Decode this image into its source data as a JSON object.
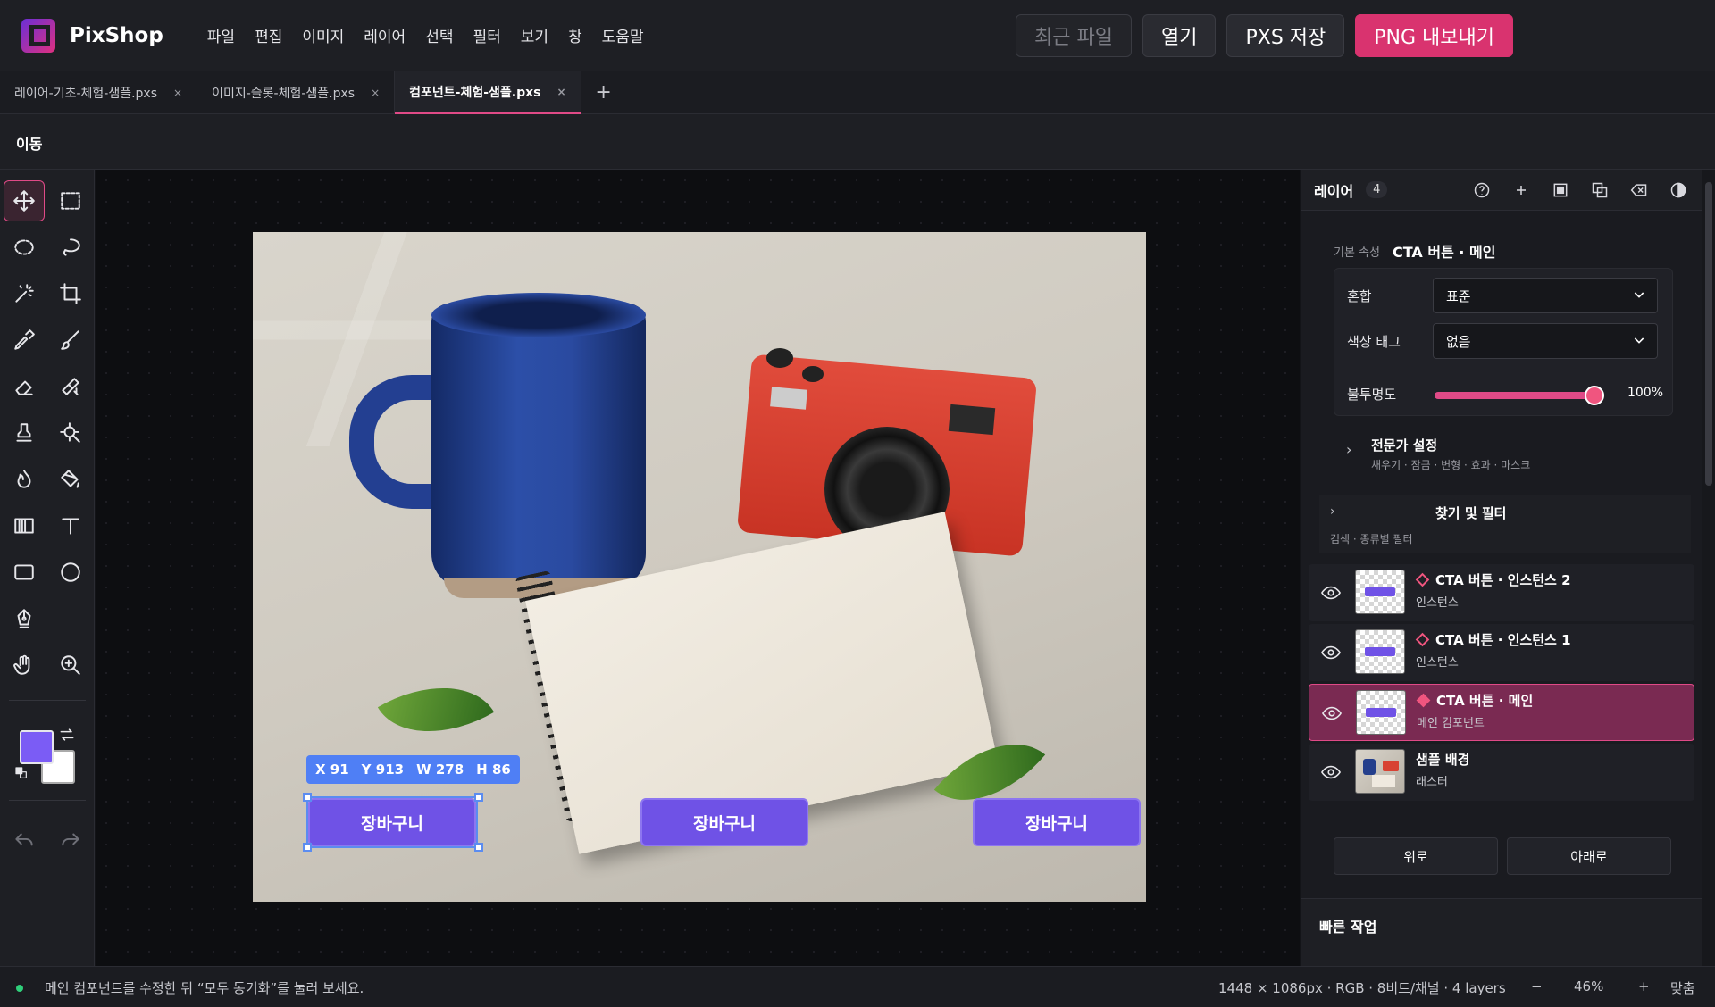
{
  "app": {
    "name": "PixShop"
  },
  "menu": [
    "파일",
    "편집",
    "이미지",
    "레이어",
    "선택",
    "필터",
    "보기",
    "창",
    "도움말"
  ],
  "actions": {
    "recent": "최근 파일",
    "open": "열기",
    "save": "PXS 저장",
    "export": "PNG 내보내기"
  },
  "tabs": [
    {
      "label": "레이어-기초-체험-샘플.pxs",
      "close": "×"
    },
    {
      "label": "이미지-슬롯-체험-샘플.pxs",
      "close": "×"
    },
    {
      "label": "컴포넌트-체험-샘플.pxs",
      "close": "×",
      "active": true
    }
  ],
  "tab_add": "+",
  "options": {
    "tool_name": "이동"
  },
  "colors": {
    "foreground": "#7b5cf5",
    "background": "#ffffff",
    "accent": "#e04a87"
  },
  "canvas": {
    "coord_badge": {
      "x": "X 91",
      "y": "Y 913",
      "w": "W 278",
      "h": "H 86"
    },
    "cta_label": "장바구니"
  },
  "panel": {
    "title": "레이어",
    "count": "4",
    "props_label": "기본 속성",
    "props_name": "CTA 버튼 · 메인",
    "blend_label": "혼합",
    "blend_value": "표준",
    "tag_label": "색상 태그",
    "tag_value": "없음",
    "opacity_label": "불투명도",
    "opacity_value": "100%",
    "opacity_fraction": 1.0,
    "expert_title": "전문가 설정",
    "expert_sub": "채우기 · 잠금 · 변형 · 효과 · 마스크",
    "find_title": "찾기 및 필터",
    "find_sub": "검색 · 종류별 필터",
    "layers": [
      {
        "name": "CTA 버튼 · 인스턴스 2",
        "type": "인스턴스"
      },
      {
        "name": "CTA 버튼 · 인스턴스 1",
        "type": "인스턴스"
      },
      {
        "name": "CTA 버튼 · 메인",
        "type": "메인 컴포넌트",
        "selected": true
      },
      {
        "name": "샘플 배경",
        "type": "래스터"
      }
    ],
    "up": "위로",
    "down": "아래로",
    "quick": "빠른 작업"
  },
  "status": {
    "message": "메인 컴포넌트를 수정한 뒤 “모두 동기화”를 눌러 보세요.",
    "info": "1448 × 1086px · RGB · 8비트/채널 · 4 layers",
    "zoom_out": "−",
    "zoom": "46%",
    "zoom_in": "+",
    "fit": "맞춤"
  }
}
